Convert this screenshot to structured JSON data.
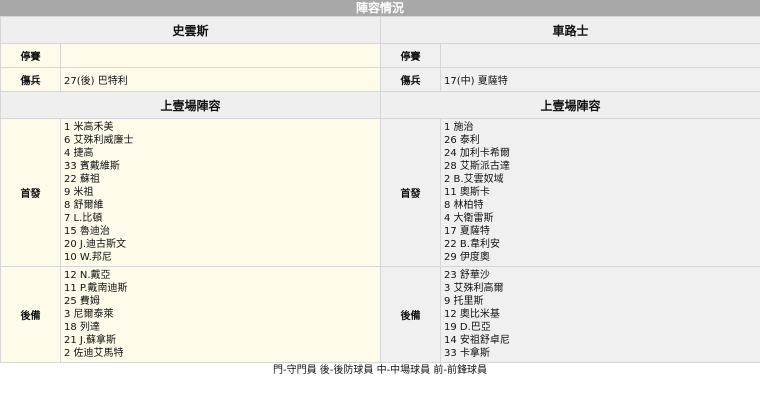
{
  "title": "陣容情況",
  "teams": {
    "left": "史雲斯",
    "right": "車路士"
  },
  "rows": {
    "suspended_label": "停賽",
    "injured_label": "傷兵",
    "left_suspended": "",
    "right_suspended": "",
    "left_injured": "27(後) 巴特利",
    "right_injured": "17(中) 夏薩特"
  },
  "last_match": {
    "header": "上壹場陣容",
    "starters_label": "首發",
    "subs_label": "後備",
    "left_starters": [
      "1 米高禾美",
      "6 艾殊利威廉士",
      "4 捷高",
      "33 賓戴維斯",
      "22 蘇祖",
      "9 米祖",
      "8 舒爾維",
      "7 L.比頓",
      "15 魯迪治",
      "20 J.迪古斯文",
      "10 W.邦尼"
    ],
    "left_subs": [
      "12 N.戴亞",
      "11 P.戴南迪斯",
      "25 費姆",
      "3 尼爾泰萊",
      "18 列達",
      "21 J.蘇拿斯",
      "2 佐迪艾馬特"
    ],
    "right_starters": [
      "1 施治",
      "26 泰利",
      "24 加利卡希爾",
      "28 艾斯派古達",
      "2 B.艾雲奴域",
      "11 奧斯卡",
      "8 林柏特",
      "4 大衛雷斯",
      "17 夏薩特",
      "22 B.韋利安",
      "29 伊度奧"
    ],
    "right_subs": [
      "23 舒華沙",
      "3 艾殊利高爾",
      "9 托里斯",
      "12 奧比米基",
      "19 D.巴亞",
      "14 安祖舒卓尼",
      "33 卡拿斯"
    ]
  },
  "legend": "門-守門員 後-後防球員 中-中場球員 前-前鋒球員"
}
